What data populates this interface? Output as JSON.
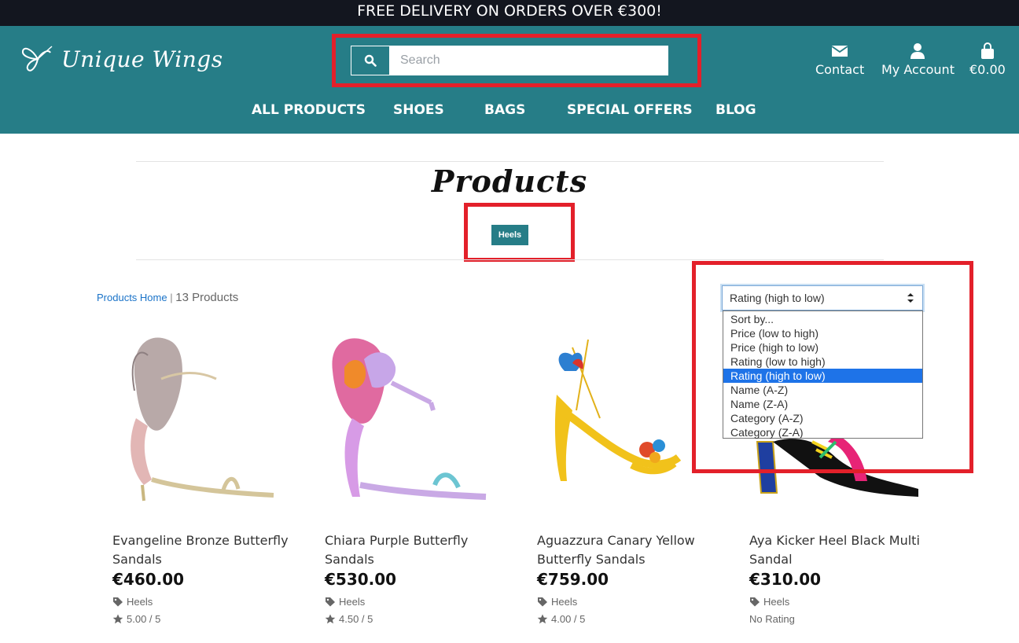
{
  "banner": {
    "text": "FREE DELIVERY ON ORDERS OVER €300!"
  },
  "header": {
    "logo_text": "Unique Wings",
    "search": {
      "placeholder": "Search"
    },
    "contact_label": "Contact",
    "account_label": "My Account",
    "cart_total": "€0.00"
  },
  "nav": {
    "items": [
      "ALL PRODUCTS",
      "SHOES",
      "BAGS",
      "SPECIAL OFFERS",
      "BLOG"
    ]
  },
  "page": {
    "title": "Products",
    "active_category": "Heels",
    "breadcrumb_link": "Products Home",
    "separator": "|",
    "product_count": "13 Products"
  },
  "sort": {
    "selected": "Rating (high to low)",
    "options": [
      "Sort by...",
      "Price (low to high)",
      "Price (high to low)",
      "Rating (low to high)",
      "Rating (high to low)",
      "Name (A-Z)",
      "Name (Z-A)",
      "Category (A-Z)",
      "Category (Z-A)"
    ]
  },
  "products": [
    {
      "name": "Evangeline Bronze Butterfly Sandals",
      "price": "€460.00",
      "category": "Heels",
      "rating": "5.00 / 5"
    },
    {
      "name": "Chiara Purple Butterfly Sandals",
      "price": "€530.00",
      "category": "Heels",
      "rating": "4.50 / 5"
    },
    {
      "name": "Aguazzura Canary Yellow Butterfly Sandals",
      "price": "€759.00",
      "category": "Heels",
      "rating": "4.00 / 5"
    },
    {
      "name": "Aya Kicker Heel Black Multi Sandal",
      "price": "€310.00",
      "category": "Heels",
      "rating": "No Rating"
    }
  ],
  "colors": {
    "brand": "#267d87",
    "topbar": "#13161f",
    "highlight": "#e3202a",
    "selected_option": "#1e73e8"
  },
  "icons": [
    "butterfly-logo-icon",
    "search-icon",
    "envelope-icon",
    "user-icon",
    "shopping-bag-icon",
    "tag-icon",
    "star-icon",
    "select-arrows-icon"
  ]
}
